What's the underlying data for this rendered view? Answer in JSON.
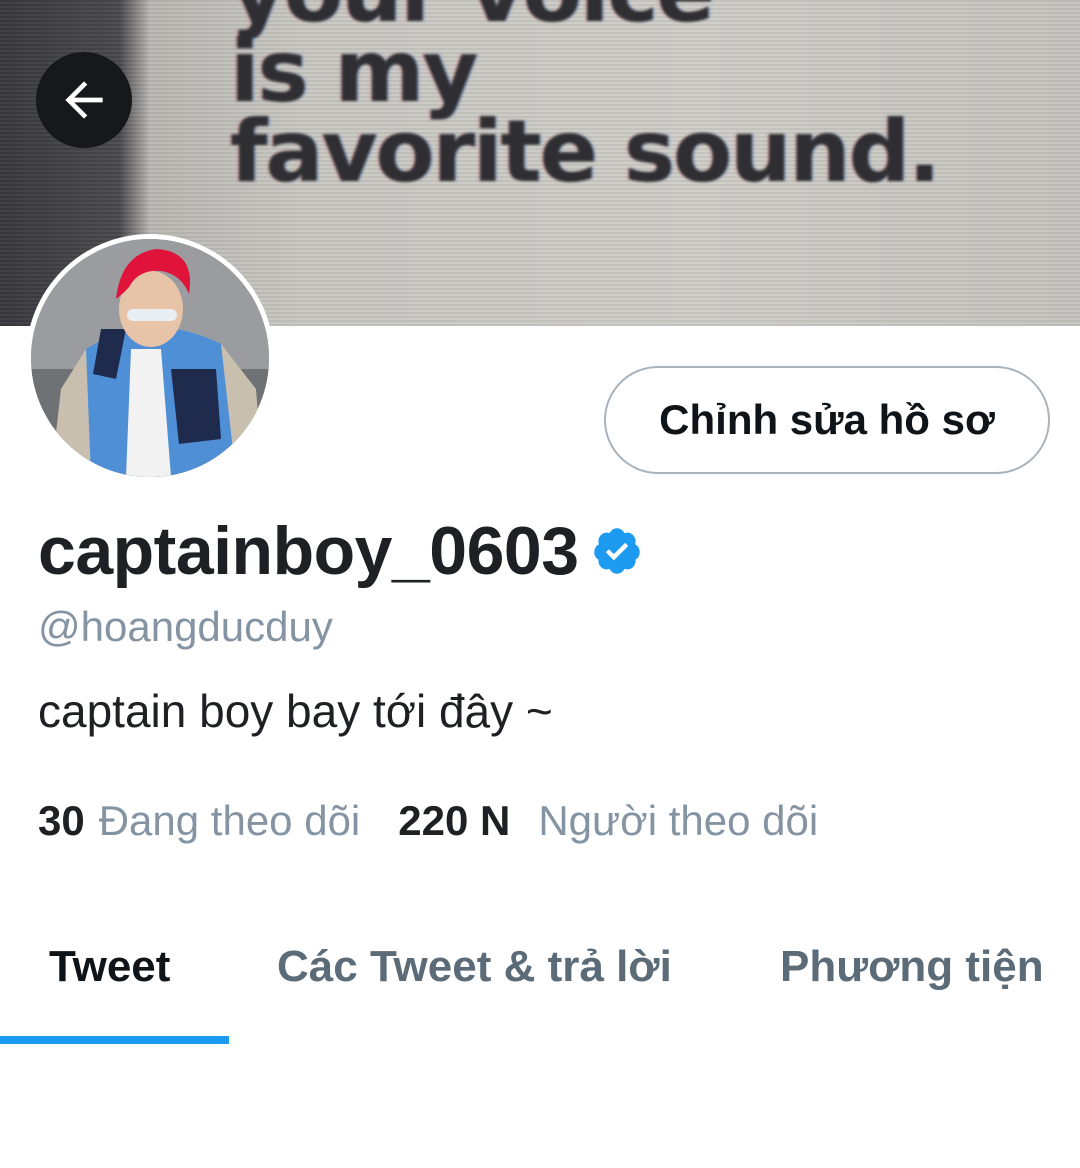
{
  "banner": {
    "lines": [
      "your voice",
      "is my",
      "favorite sound."
    ],
    "back_icon": "arrow-left-icon"
  },
  "profile": {
    "edit_button_label": "Chỉnh sửa hồ sơ",
    "display_name": "captainboy_0603",
    "verified_icon": "verified-badge-icon",
    "verified_color": "#1d9bf0",
    "handle": "@hoangducduy",
    "bio": "captain boy bay tới đây ~"
  },
  "stats": {
    "following_count": "30",
    "following_label": "Đang theo dõi",
    "followers_count": "220 N",
    "followers_label": "Người theo dõi"
  },
  "tabs": [
    {
      "label": "Tweet",
      "active": true
    },
    {
      "label": "Các Tweet & trả lời",
      "active": false
    },
    {
      "label": "Phương tiện",
      "active": false
    }
  ],
  "colors": {
    "accent": "#1d9bf0",
    "text_primary": "#0f1419",
    "text_secondary": "#8494a3"
  }
}
